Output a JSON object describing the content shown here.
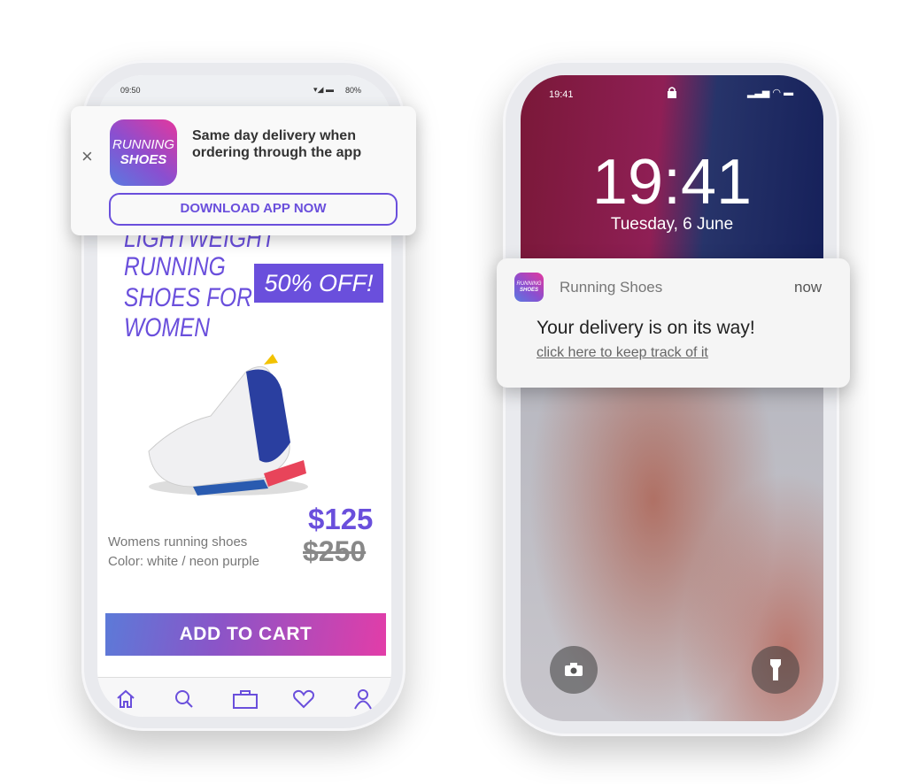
{
  "shop_phone": {
    "status": {
      "time": "09:50",
      "battery": "80%"
    },
    "banner": {
      "close": "×",
      "icon_line1": "RUNNING",
      "icon_line2": "SHOES",
      "message": "Same day delivery when ordering through the app",
      "button": "DOWNLOAD APP NOW"
    },
    "headline": [
      "LIGHTWEIGHT",
      "RUNNING",
      "SHOES FOR",
      "WOMEN"
    ],
    "discount_badge": "50% OFF!",
    "product": {
      "description": "Womens running shoes",
      "color": "Color: white / neon purple",
      "price": "$125",
      "old_price": "$250"
    },
    "add_to_cart": "ADD TO CART",
    "nav": [
      "home-icon",
      "search-icon",
      "bag-icon",
      "heart-icon",
      "user-icon"
    ],
    "accent": "#6a4fdc"
  },
  "lock_phone": {
    "status": {
      "time": "19:41"
    },
    "clock": "19:41",
    "date": "Tuesday, 6 June",
    "notification": {
      "app": "Running Shoes",
      "time": "now",
      "icon_line1": "RUNNING",
      "icon_line2": "SHOES",
      "title": "Your delivery is on its way!",
      "link": "click here to keep track of it"
    }
  }
}
